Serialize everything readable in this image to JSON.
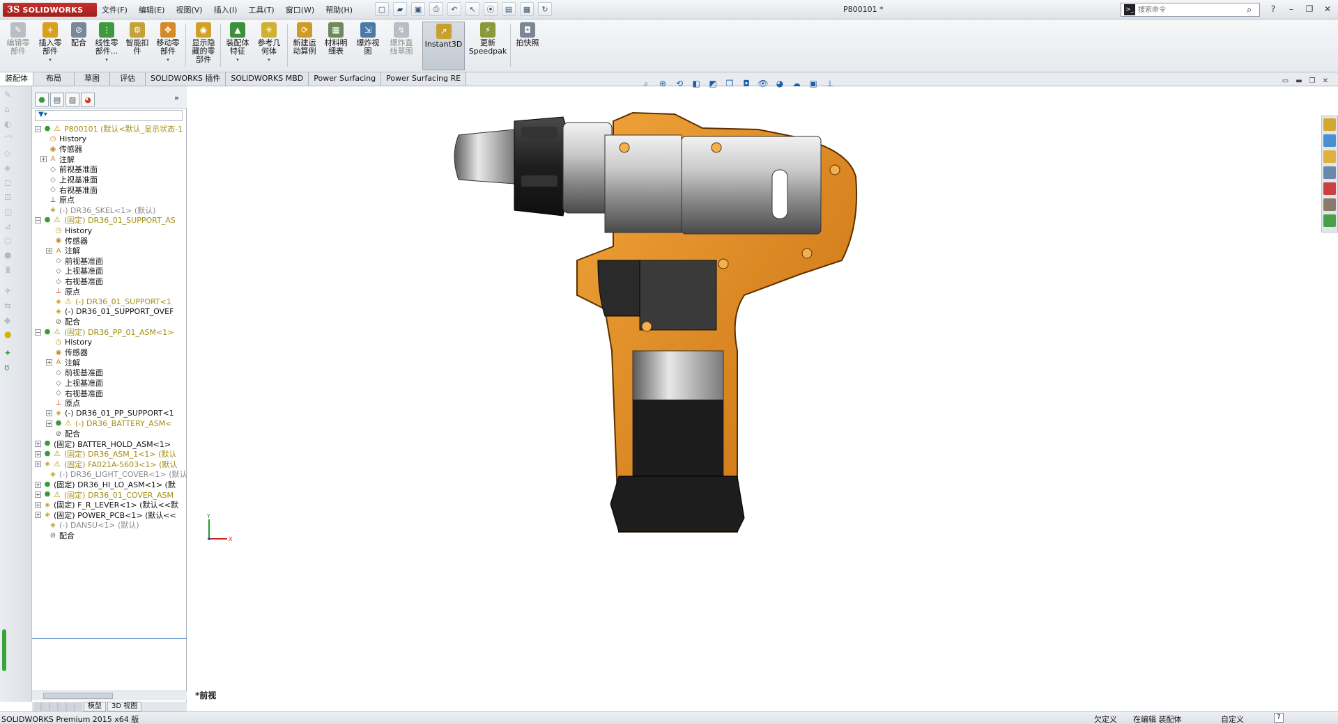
{
  "app": {
    "logo_mark": "3S",
    "logo_text": "SOLIDWORKS",
    "document_title": "P800101 *"
  },
  "menu": [
    "文件(F)",
    "编辑(E)",
    "视图(V)",
    "插入(I)",
    "工具(T)",
    "窗口(W)",
    "帮助(H)"
  ],
  "search": {
    "placeholder": "搜索命令"
  },
  "commands": {
    "edit_component": "编辑零\n部件",
    "insert_component": "插入零\n部件",
    "mate": "配合",
    "linear_pattern": "线性零\n部件...",
    "smart_fasteners": "智能扣\n件",
    "move_component": "移动零\n部件",
    "show_hidden": "显示隐\n藏的零\n部件",
    "assembly_features": "装配体\n特征",
    "reference_geometry": "参考几\n何体",
    "new_motion_study": "新建运\n动算例",
    "bom": "材料明\n细表",
    "exploded_view": "爆炸视\n图",
    "explode_line": "爆炸直\n线草图",
    "instant3d": "Instant3D",
    "update_speedpak": "更新\nSpeedpak",
    "snapshot": "拍快照"
  },
  "tabs": [
    "装配体",
    "布局",
    "草图",
    "评估",
    "SOLIDWORKS 插件",
    "SOLIDWORKS MBD",
    "Power Surfacing",
    "Power Surfacing RE"
  ],
  "feature_tree": {
    "filter_icon": "filter-icon",
    "nodes": [
      {
        "label": "P800101  (默认<默认_显示状态-1"
      },
      {
        "label": "History"
      },
      {
        "label": "传感器"
      },
      {
        "label": "注解"
      },
      {
        "label": "前视基准面"
      },
      {
        "label": "上视基准面"
      },
      {
        "label": "右视基准面"
      },
      {
        "label": "原点"
      },
      {
        "label": "(-) DR36_SKEL<1> (默认)"
      },
      {
        "label": "(固定) DR36_01_SUPPORT_AS"
      },
      {
        "label": "History"
      },
      {
        "label": "传感器"
      },
      {
        "label": "注解"
      },
      {
        "label": "前视基准面"
      },
      {
        "label": "上视基准面"
      },
      {
        "label": "右视基准面"
      },
      {
        "label": "原点"
      },
      {
        "label": "(-) DR36_01_SUPPORT<1"
      },
      {
        "label": "(-) DR36_01_SUPPORT_OVEF"
      },
      {
        "label": "配合"
      },
      {
        "label": "(固定) DR36_PP_01_ASM<1>"
      },
      {
        "label": "History"
      },
      {
        "label": "传感器"
      },
      {
        "label": "注解"
      },
      {
        "label": "前视基准面"
      },
      {
        "label": "上视基准面"
      },
      {
        "label": "右视基准面"
      },
      {
        "label": "原点"
      },
      {
        "label": "(-) DR36_01_PP_SUPPORT<1"
      },
      {
        "label": "(-) DR36_BATTERY_ASM<"
      },
      {
        "label": "配合"
      },
      {
        "label": "(固定) BATTER_HOLD_ASM<1>"
      },
      {
        "label": "(固定) DR36_ASM_1<1> (默认"
      },
      {
        "label": "(固定) FA021A-5603<1> (默认"
      },
      {
        "label": "(-) DR36_LIGHT_COVER<1> (默认"
      },
      {
        "label": "(固定) DR36_HI_LO_ASM<1> (默"
      },
      {
        "label": "(固定) DR36_01_COVER_ASM"
      },
      {
        "label": "(固定) F_R_LEVER<1> (默认<<默"
      },
      {
        "label": "(固定) POWER_PCB<1> (默认<<"
      },
      {
        "label": "(-) DANSU<1> (默认)"
      },
      {
        "label": "配合"
      }
    ]
  },
  "model_tabs": [
    "模型",
    "3D 视图"
  ],
  "viewport": {
    "view_name": "*前视",
    "triad_x": "X",
    "triad_y": "Y"
  },
  "statusbar": {
    "app_version": "SOLIDWORKS Premium 2015 x64 版",
    "status_defined": "欠定义",
    "status_editing": "在编辑 装配体",
    "units": "自定义",
    "help": "?"
  },
  "colors": {
    "accent": "#1b5fa8",
    "warning": "#c19a00",
    "drill_orange": "#e08a1e",
    "body_dark": "#2a2a2a"
  }
}
